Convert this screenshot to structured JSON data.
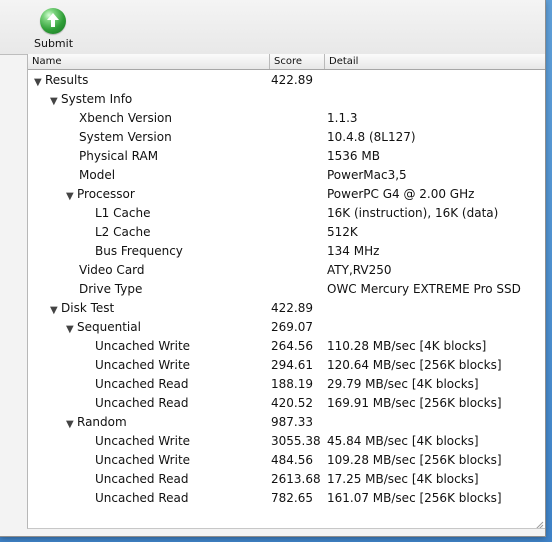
{
  "toolbar": {
    "submit_label": "Submit"
  },
  "table": {
    "headers": {
      "name": "Name",
      "score": "Score",
      "detail": "Detail"
    },
    "rows": [
      {
        "name": "Results",
        "score": "422.89",
        "detail": ""
      },
      {
        "name": "System Info",
        "score": "",
        "detail": ""
      },
      {
        "name": "Xbench Version",
        "score": "",
        "detail": "1.1.3"
      },
      {
        "name": "System Version",
        "score": "",
        "detail": "10.4.8 (8L127)"
      },
      {
        "name": "Physical RAM",
        "score": "",
        "detail": "1536 MB"
      },
      {
        "name": "Model",
        "score": "",
        "detail": "PowerMac3,5"
      },
      {
        "name": "Processor",
        "score": "",
        "detail": "PowerPC G4 @ 2.00 GHz"
      },
      {
        "name": "L1 Cache",
        "score": "",
        "detail": "16K (instruction), 16K (data)"
      },
      {
        "name": "L2 Cache",
        "score": "",
        "detail": "512K"
      },
      {
        "name": "Bus Frequency",
        "score": "",
        "detail": "134 MHz"
      },
      {
        "name": "Video Card",
        "score": "",
        "detail": "ATY,RV250"
      },
      {
        "name": "Drive Type",
        "score": "",
        "detail": "OWC Mercury EXTREME Pro SSD"
      },
      {
        "name": "Disk Test",
        "score": "422.89",
        "detail": ""
      },
      {
        "name": "Sequential",
        "score": "269.07",
        "detail": ""
      },
      {
        "name": "Uncached Write",
        "score": "264.56",
        "detail": "110.28 MB/sec [4K blocks]"
      },
      {
        "name": "Uncached Write",
        "score": "294.61",
        "detail": "120.64 MB/sec [256K blocks]"
      },
      {
        "name": "Uncached Read",
        "score": "188.19",
        "detail": "29.79 MB/sec [4K blocks]"
      },
      {
        "name": "Uncached Read",
        "score": "420.52",
        "detail": "169.91 MB/sec [256K blocks]"
      },
      {
        "name": "Random",
        "score": "987.33",
        "detail": ""
      },
      {
        "name": "Uncached Write",
        "score": "3055.38",
        "detail": "45.84 MB/sec [4K blocks]"
      },
      {
        "name": "Uncached Write",
        "score": "484.56",
        "detail": "109.28 MB/sec [256K blocks]"
      },
      {
        "name": "Uncached Read",
        "score": "2613.68",
        "detail": "17.25 MB/sec [4K blocks]"
      },
      {
        "name": "Uncached Read",
        "score": "782.65",
        "detail": "161.07 MB/sec [256K blocks]"
      }
    ]
  },
  "icons": {
    "submit": "arrow-up-icon",
    "disclosure": "disclosure-triangle-icon",
    "resize": "resize-grip-icon"
  },
  "colors": {
    "submit_green": "#2f9e37",
    "desktop_blue": "#3f83c8"
  }
}
